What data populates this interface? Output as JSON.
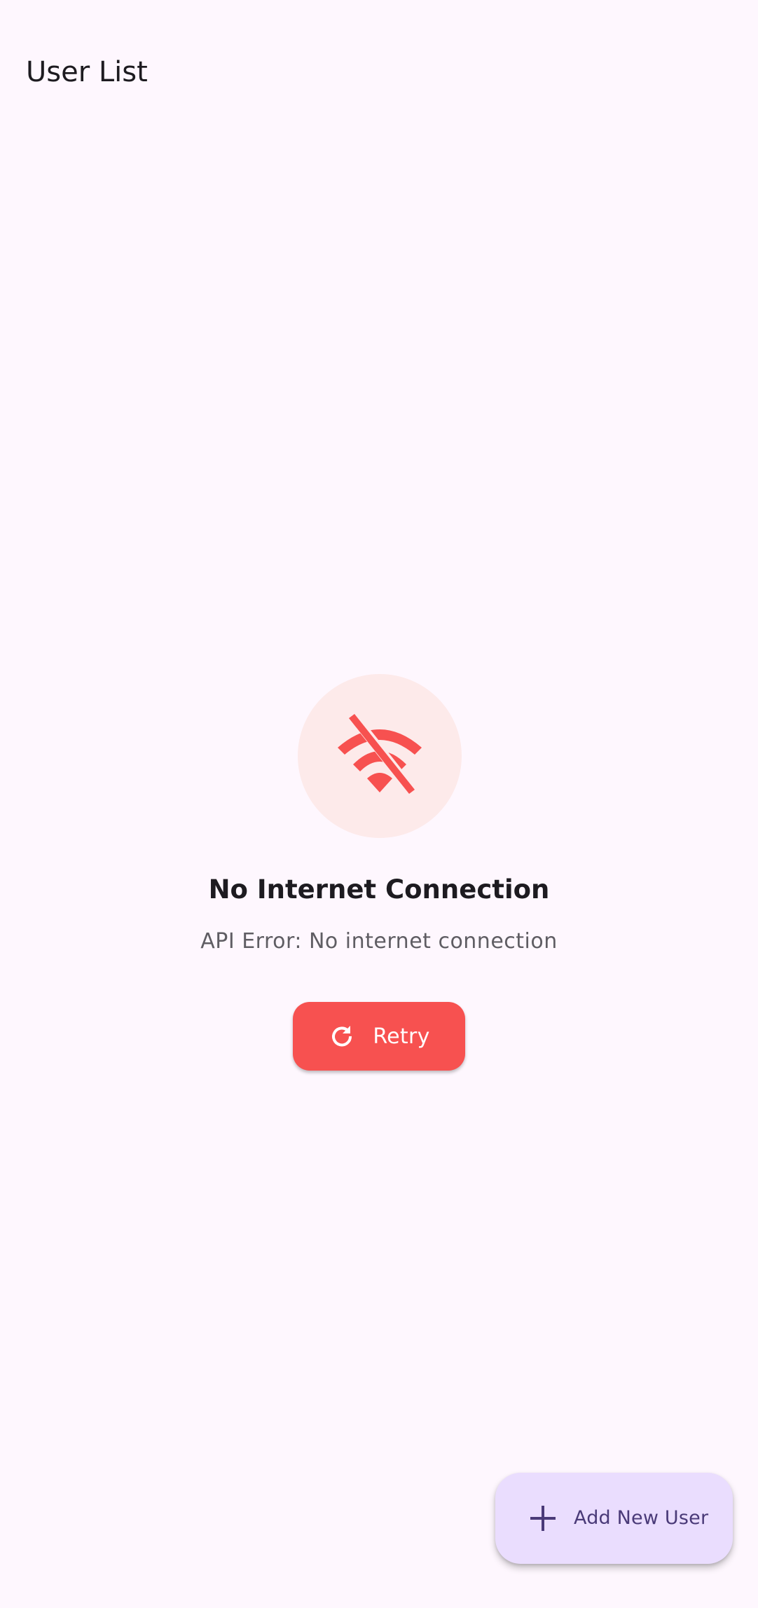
{
  "app_bar": {
    "title": "User List"
  },
  "error_state": {
    "icon": "wifi-off-icon",
    "title": "No Internet Connection",
    "message": "API Error: No internet connection",
    "retry_button": {
      "icon": "refresh-icon",
      "label": "Retry"
    }
  },
  "fab": {
    "icon": "plus-icon",
    "label": "Add New User"
  },
  "colors": {
    "background": "#fef7fe",
    "error_accent": "#f75150",
    "error_icon_bg": "#fdeaea",
    "fab_bg": "#eaddfe",
    "fab_text": "#4a3a78"
  }
}
